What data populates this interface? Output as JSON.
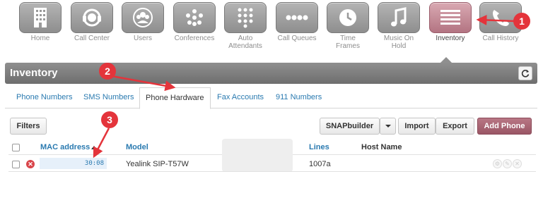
{
  "nav": {
    "items": [
      {
        "label": "Home",
        "icon": "building-icon"
      },
      {
        "label": "Call Center",
        "icon": "headset-icon"
      },
      {
        "label": "Users",
        "icon": "users-icon"
      },
      {
        "label": "Conferences",
        "icon": "conference-icon"
      },
      {
        "label": "Auto\nAttendants",
        "icon": "keypad-icon"
      },
      {
        "label": "Call Queues",
        "icon": "queue-icon"
      },
      {
        "label": "Time\nFrames",
        "icon": "clock-icon"
      },
      {
        "label": "Music On\nHold",
        "icon": "music-note-icon"
      },
      {
        "label": "Inventory",
        "icon": "list-icon"
      },
      {
        "label": "Call History",
        "icon": "phone-history-icon"
      }
    ],
    "active": "Inventory"
  },
  "annotations": [
    "1",
    "2",
    "3"
  ],
  "inventory": {
    "title": "Inventory"
  },
  "tabs": [
    {
      "label": "Phone Numbers"
    },
    {
      "label": "SMS Numbers"
    },
    {
      "label": "Phone Hardware"
    },
    {
      "label": "Fax Accounts"
    },
    {
      "label": "911 Numbers"
    }
  ],
  "active_tab": "Phone Hardware",
  "toolbar": {
    "filters": "Filters",
    "snapbuilder": "SNAPbuilder",
    "import": "Import",
    "export": "Export",
    "add_phone": "Add Phone"
  },
  "table": {
    "headers": {
      "mac": "MAC address",
      "model": "Model",
      "lines": "Lines",
      "host": "Host Name"
    },
    "rows": [
      {
        "mac": "30:08",
        "model": "Yealink SIP-T57W",
        "lines": "1007a",
        "host": ""
      }
    ]
  },
  "colors": {
    "accent": "#b37482",
    "link": "#2a7ab0",
    "error": "#d9454a",
    "marker": "#e4343b"
  }
}
